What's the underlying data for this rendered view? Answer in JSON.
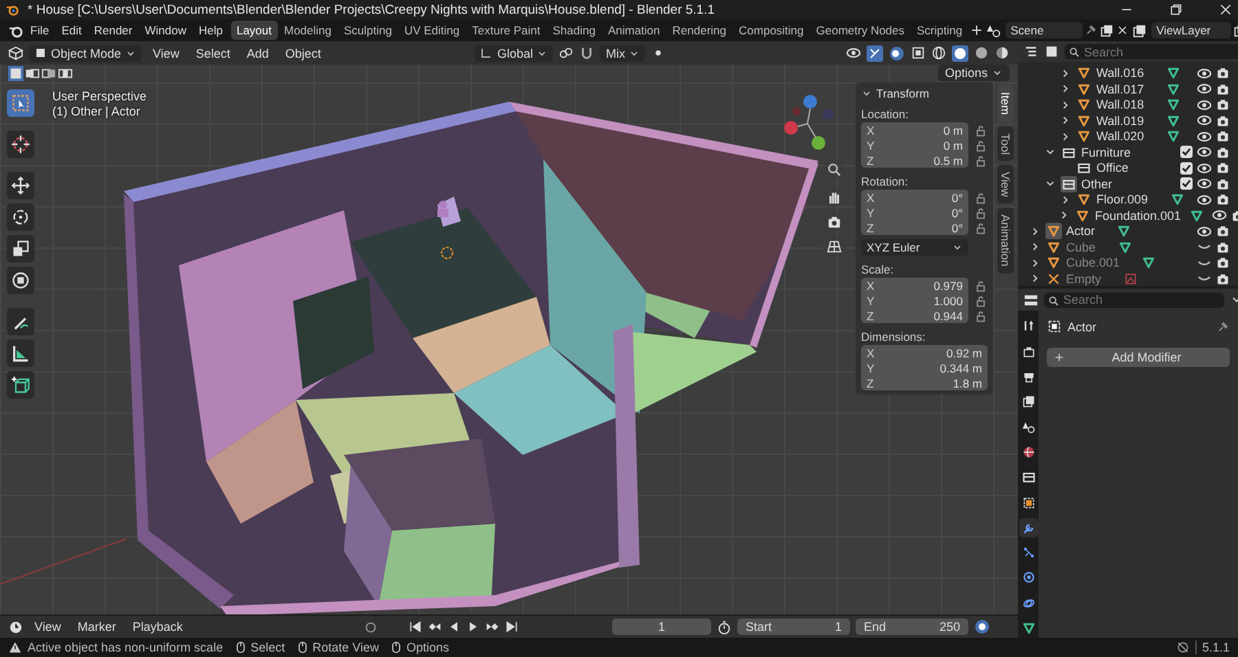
{
  "title_bar": {
    "title": "* House [C:\\Users\\User\\Documents\\Blender\\Blender Projects\\Creepy Nights with Marquis\\House.blend] - Blender 5.1.1"
  },
  "top_bar": {
    "menus": [
      "File",
      "Edit",
      "Render",
      "Window",
      "Help"
    ],
    "workspaces": [
      {
        "label": "Layout",
        "selected": true
      },
      {
        "label": "Modeling",
        "selected": false
      },
      {
        "label": "Sculpting",
        "selected": false
      },
      {
        "label": "UV Editing",
        "selected": false
      },
      {
        "label": "Texture Paint",
        "selected": false
      },
      {
        "label": "Shading",
        "selected": false
      },
      {
        "label": "Animation",
        "selected": false
      },
      {
        "label": "Rendering",
        "selected": false
      },
      {
        "label": "Compositing",
        "selected": false
      },
      {
        "label": "Geometry Nodes",
        "selected": false
      },
      {
        "label": "Scripting",
        "selected": false
      }
    ],
    "scene": "Scene",
    "view_layer": "ViewLayer"
  },
  "viewport": {
    "mode": "Object Mode",
    "menus": [
      "View",
      "Select",
      "Add",
      "Object"
    ],
    "orientation": "Global",
    "snap_target": "Mix",
    "options": "Options",
    "view_name": "User Perspective",
    "context": "(1) Other | Actor",
    "tools": [
      {
        "kind": "select",
        "selected": true
      },
      {
        "kind": "cursor",
        "selected": false
      },
      {
        "kind": "move",
        "selected": false
      },
      {
        "kind": "rotate",
        "selected": false
      },
      {
        "kind": "scale",
        "selected": false
      },
      {
        "kind": "transform",
        "selected": false
      },
      {
        "kind": "annotate",
        "selected": false
      },
      {
        "kind": "measure",
        "selected": false
      },
      {
        "kind": "add_cube",
        "selected": false
      }
    ],
    "sidebar_tabs": [
      {
        "label": "Item",
        "selected": true
      },
      {
        "label": "Tool",
        "selected": false
      },
      {
        "label": "View",
        "selected": false
      },
      {
        "label": "Animation",
        "selected": false
      }
    ],
    "transform": {
      "title": "Transform",
      "groups": [
        {
          "label": "Location:",
          "lockable": true,
          "fields": [
            {
              "axis": "X",
              "value": "0 m"
            },
            {
              "axis": "Y",
              "value": "0 m"
            },
            {
              "axis": "Z",
              "value": "0.5 m"
            }
          ]
        },
        {
          "label": "Rotation:",
          "lockable": true,
          "fields": [
            {
              "axis": "X",
              "value": "0°"
            },
            {
              "axis": "Y",
              "value": "0°"
            },
            {
              "axis": "Z",
              "value": "0°"
            }
          ],
          "mode": "XYZ Euler"
        },
        {
          "label": "Scale:",
          "lockable": true,
          "fields": [
            {
              "axis": "X",
              "value": "0.979"
            },
            {
              "axis": "Y",
              "value": "1.000"
            },
            {
              "axis": "Z",
              "value": "0.944"
            }
          ]
        },
        {
          "label": "Dimensions:",
          "lockable": false,
          "fields": [
            {
              "axis": "X",
              "value": "0.92 m"
            },
            {
              "axis": "Y",
              "value": "0.344 m"
            },
            {
              "axis": "Z",
              "value": "1.8 m"
            }
          ]
        }
      ]
    }
  },
  "outliner": {
    "search_placeholder": "Search",
    "tree": [
      {
        "children": [
          {
            "children": [
              {
                "name": "Wall.016",
                "kind": "mesh",
                "expanded": false,
                "visible": true,
                "selected": false
              },
              {
                "name": "Wall.017",
                "kind": "mesh",
                "expanded": false,
                "visible": true,
                "selected": false
              },
              {
                "name": "Wall.018",
                "kind": "mesh",
                "expanded": false,
                "visible": true,
                "selected": false
              },
              {
                "name": "Wall.019",
                "kind": "mesh",
                "expanded": false,
                "visible": true,
                "selected": false
              },
              {
                "name": "Wall.020",
                "kind": "mesh",
                "expanded": false,
                "visible": true,
                "selected": false
              }
            ]
          },
          {
            "name": "Furniture",
            "kind": "collection",
            "expanded": true,
            "checked": true,
            "visible": true,
            "selected": false,
            "children": [
              {
                "name": "Office",
                "kind": "collection",
                "checked": true,
                "visible": true,
                "selected": false
              }
            ]
          },
          {
            "name": "Other",
            "kind": "collection",
            "expanded": true,
            "checked": true,
            "visible": true,
            "selected": true,
            "children": [
              {
                "name": "Floor.009",
                "kind": "mesh",
                "expanded": false,
                "visible": true,
                "selected": false
              },
              {
                "name": "Foundation.001",
                "kind": "mesh",
                "expanded": false,
                "visible": true,
                "selected": false
              }
            ]
          }
        ]
      },
      {
        "name": "Actor",
        "kind": "mesh",
        "expanded": false,
        "visible": true,
        "selected": true
      },
      {
        "name": "Cube",
        "kind": "mesh",
        "expanded": false,
        "visible": false,
        "selected": false
      },
      {
        "name": "Cube.001",
        "kind": "mesh",
        "expanded": false,
        "visible": false,
        "selected": false
      },
      {
        "name": "Empty",
        "kind": "empty",
        "expanded": false,
        "visible": false,
        "selected": false
      }
    ]
  },
  "properties": {
    "search_placeholder": "Search",
    "tabs": [
      {
        "kind": "tool",
        "selected": false
      },
      {
        "kind": "render",
        "selected": false
      },
      {
        "kind": "output",
        "selected": false
      },
      {
        "kind": "view_layer",
        "selected": false
      },
      {
        "kind": "scene",
        "selected": false
      },
      {
        "kind": "world",
        "selected": false
      },
      {
        "kind": "collection",
        "selected": false
      },
      {
        "kind": "object",
        "selected": false
      },
      {
        "kind": "modifiers",
        "selected": true
      },
      {
        "kind": "particles",
        "selected": false
      },
      {
        "kind": "physics",
        "selected": false
      },
      {
        "kind": "constraints",
        "selected": false
      },
      {
        "kind": "data",
        "selected": false
      }
    ],
    "object_name": "Actor",
    "add_modifier": "Add Modifier"
  },
  "timeline": {
    "menus": [
      "View",
      "Marker",
      "Playback"
    ],
    "current_frame": "1",
    "start_label": "Start",
    "start": "1",
    "end_label": "End",
    "end": "250"
  },
  "status_bar": {
    "message": "Active object has non-uniform scale",
    "hints": [
      "Select",
      "Rotate View",
      "Options"
    ],
    "version": "5.1.1"
  }
}
